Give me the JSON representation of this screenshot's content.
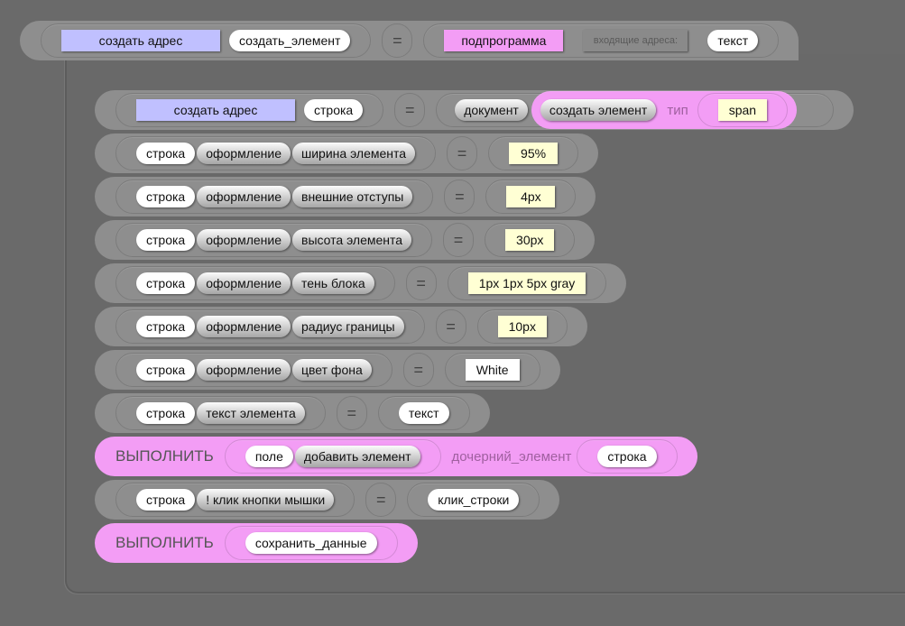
{
  "header": {
    "address_label": "создать адрес",
    "name": "создать_элемент",
    "equals": "=",
    "subroutine": "подпрограмма",
    "incoming_label": "входящие адреса:",
    "param": "текст"
  },
  "colors": {
    "background": "#6a6a6a",
    "block": "#8e8e8e",
    "execute": "#f39df5",
    "address": "#c0c0ff",
    "literal": "#ffffd4"
  },
  "rows": [
    {
      "type": "assign",
      "left": [
        {
          "k": "addr",
          "t": "создать адрес"
        },
        {
          "k": "var",
          "t": "строка"
        }
      ],
      "right": [
        {
          "k": "prop",
          "t": "документ"
        }
      ],
      "call": {
        "method": "создать элемент",
        "arg_label": "тип",
        "arg": {
          "k": "lit",
          "t": "span"
        }
      }
    },
    {
      "type": "assign",
      "left": [
        {
          "k": "var",
          "t": "строка"
        },
        {
          "k": "prop",
          "t": "оформление"
        },
        {
          "k": "prop",
          "t": "ширина элемента"
        }
      ],
      "right": [
        {
          "k": "lit",
          "t": "95%"
        }
      ]
    },
    {
      "type": "assign",
      "left": [
        {
          "k": "var",
          "t": "строка"
        },
        {
          "k": "prop",
          "t": "оформление"
        },
        {
          "k": "prop",
          "t": "внешние отступы"
        }
      ],
      "right": [
        {
          "k": "lit",
          "t": "4px"
        }
      ]
    },
    {
      "type": "assign",
      "left": [
        {
          "k": "var",
          "t": "строка"
        },
        {
          "k": "prop",
          "t": "оформление"
        },
        {
          "k": "prop",
          "t": "высота элемента"
        }
      ],
      "right": [
        {
          "k": "lit",
          "t": "30px"
        }
      ]
    },
    {
      "type": "assign",
      "left": [
        {
          "k": "var",
          "t": "строка"
        },
        {
          "k": "prop",
          "t": "оформление"
        },
        {
          "k": "prop",
          "t": "тень блока"
        }
      ],
      "right": [
        {
          "k": "lit",
          "t": "1px 1px 5px gray"
        }
      ]
    },
    {
      "type": "assign",
      "left": [
        {
          "k": "var",
          "t": "строка"
        },
        {
          "k": "prop",
          "t": "оформление"
        },
        {
          "k": "prop",
          "t": "радиус границы"
        }
      ],
      "right": [
        {
          "k": "lit",
          "t": "10px"
        }
      ]
    },
    {
      "type": "assign",
      "left": [
        {
          "k": "var",
          "t": "строка"
        },
        {
          "k": "prop",
          "t": "оформление"
        },
        {
          "k": "prop",
          "t": "цвет фона"
        }
      ],
      "right": [
        {
          "k": "wrect",
          "t": "White"
        }
      ]
    },
    {
      "type": "assign",
      "left": [
        {
          "k": "var",
          "t": "строка"
        },
        {
          "k": "prop",
          "t": "текст элемента"
        }
      ],
      "right": [
        {
          "k": "var",
          "t": "текст"
        }
      ]
    },
    {
      "type": "exec",
      "keyword": "ВЫПОЛНИТЬ",
      "target": [
        {
          "k": "var",
          "t": "поле"
        },
        {
          "k": "prop",
          "t": "добавить элемент"
        }
      ],
      "arg_label": "дочерний_элемент",
      "arg": [
        {
          "k": "var",
          "t": "строка"
        }
      ]
    },
    {
      "type": "assign",
      "left": [
        {
          "k": "var",
          "t": "строка"
        },
        {
          "k": "prop",
          "t": "! клик кнопки мышки"
        }
      ],
      "right": [
        {
          "k": "var",
          "t": "клик_строки"
        }
      ]
    },
    {
      "type": "exec",
      "keyword": "ВЫПОЛНИТЬ",
      "target": [
        {
          "k": "var",
          "t": "сохранить_данные"
        }
      ]
    }
  ],
  "equals": "="
}
